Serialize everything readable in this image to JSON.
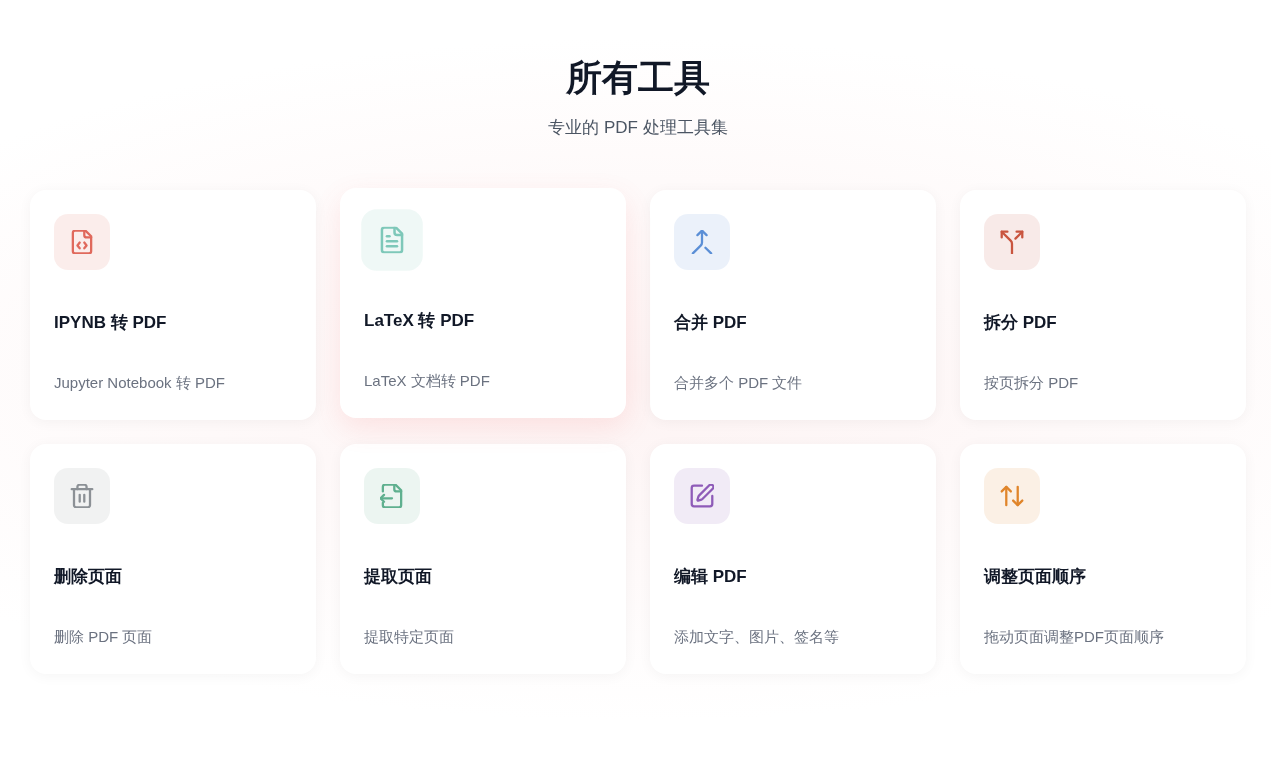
{
  "header": {
    "title": "所有工具",
    "subtitle": "专业的 PDF 处理工具集"
  },
  "tools": [
    {
      "title": "IPYNB 转 PDF",
      "description": "Jupyter Notebook 转 PDF",
      "color": "#e0695c",
      "hovered": false
    },
    {
      "title": "LaTeX 转 PDF",
      "description": "LaTeX 文档转 PDF",
      "color": "#7ec8b9",
      "hovered": true
    },
    {
      "title": "合并 PDF",
      "description": "合并多个 PDF 文件",
      "color": "#5b8fd6",
      "hovered": false
    },
    {
      "title": "拆分 PDF",
      "description": "按页拆分 PDF",
      "color": "#c9553f",
      "hovered": false
    },
    {
      "title": "删除页面",
      "description": "删除 PDF 页面",
      "color": "#8c9196",
      "hovered": false
    },
    {
      "title": "提取页面",
      "description": "提取特定页面",
      "color": "#5fb08f",
      "hovered": false
    },
    {
      "title": "编辑 PDF",
      "description": "添加文字、图片、签名等",
      "color": "#8e5bb8",
      "hovered": false
    },
    {
      "title": "调整页面顺序",
      "description": "拖动页面调整PDF页面顺序",
      "color": "#e0852a",
      "hovered": false
    }
  ]
}
